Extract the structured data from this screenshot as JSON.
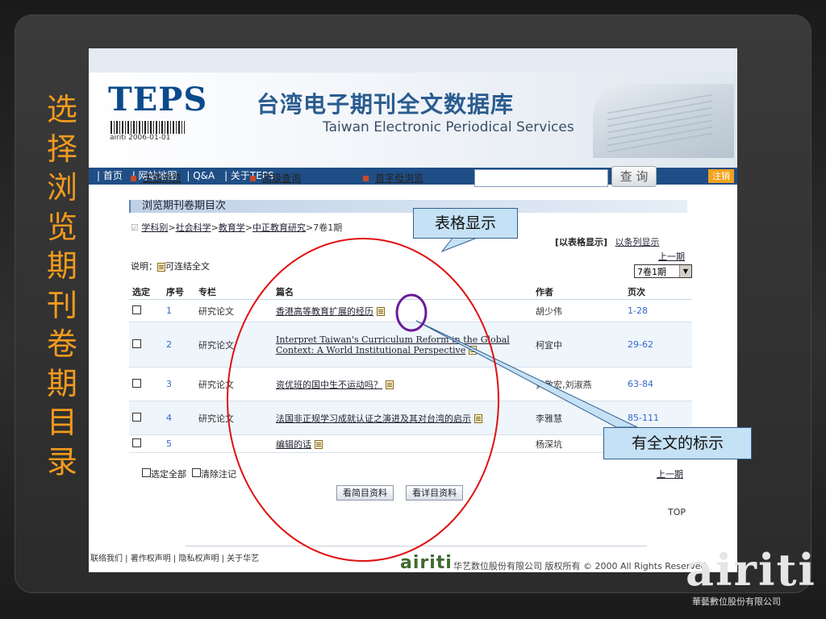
{
  "slide": {
    "vertical_title": "选择浏览期刊卷期目录",
    "corner_logo": "airiti",
    "corner_sub": "華藝數位股份有限公司"
  },
  "banner": {
    "logo": "TEPS",
    "barcode_text": "airiti 2006-01-01",
    "title": "台湾电子期刊全文数据库",
    "subtitle": "Taiwan Electronic Periodical Services"
  },
  "nav": {
    "items": [
      "| 首页",
      "| 网站地图",
      "| Q&A",
      "| 关于TEPS"
    ],
    "logout": "注销"
  },
  "tools": {
    "topic": "主题浏览",
    "advanced": "高级查询",
    "initial": "首字母浏览",
    "search_placeholder": "",
    "search_button": "查 询"
  },
  "section": {
    "title": "浏览期刊卷期目次"
  },
  "breadcrumb": {
    "parts": [
      "学科别",
      "社会科学",
      "教育学",
      "中正教育研究"
    ],
    "current": ">7卷1期"
  },
  "display": {
    "table_mode": "[以表格显示]",
    "list_mode": "以条列显示",
    "prev": "上一期",
    "issue": "7卷1期"
  },
  "note": {
    "label": "说明：",
    "text": "可连结全文"
  },
  "table": {
    "headers": [
      "选定",
      "序号",
      "专栏",
      "篇名",
      "作者",
      "页次"
    ],
    "rows": [
      {
        "num": "1",
        "column": "研究论文",
        "title": "香港高等教育扩展的经历",
        "author": "胡少伟",
        "pages": "1-28"
      },
      {
        "num": "2",
        "column": "研究论文",
        "title": "Interpret Taiwan's Curriculum Reform in the Global Context: A World Institutional Perspective",
        "author": "柯宜中",
        "pages": "29-62"
      },
      {
        "num": "3",
        "column": "研究论文",
        "title": "资优班的国中生不运动吗？",
        "author": "黄敬宏,刘淑燕",
        "pages": "63-84"
      },
      {
        "num": "4",
        "column": "研究论文",
        "title": "法国非正规学习成就认证之演进及其对台湾的启示",
        "author": "李雅慧",
        "pages": "85-111"
      },
      {
        "num": "5",
        "column": "",
        "title": "编辑的话",
        "author": "杨深坑",
        "pages": ""
      }
    ]
  },
  "bulk": {
    "select_all": "选定全部",
    "clear": "清除注记",
    "prev": "上一期"
  },
  "actions": {
    "brief": "看简目资料",
    "detail": "看详目资料",
    "top": "TOP"
  },
  "footer": {
    "links": "联络我们 | 著作权声明 | 隐私权声明 | 关于华艺",
    "brand": "airiti",
    "copy": "华艺数位股份有限公司 版权所有 © 2000 All Rights Reserved"
  },
  "callouts": {
    "table_display": "表格显示",
    "fulltext_mark": "有全文的标示"
  },
  "colors": {
    "accent": "#f29a1e",
    "nav": "#1f4e86",
    "callout_bg": "#c5e1f5",
    "red_circle": "#e01010",
    "purple_circle": "#6a1b9a"
  }
}
